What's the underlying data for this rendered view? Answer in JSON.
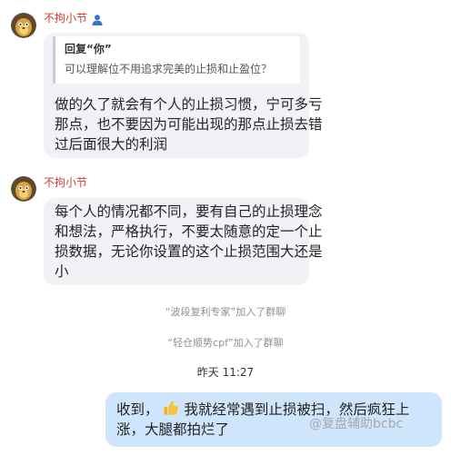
{
  "messages": [
    {
      "username": "不拘小节",
      "quote": {
        "title": "回复“你”",
        "text": "可以理解位不用追求完美的止损和止盈位？"
      },
      "lines": [
        "做的久了就会有个人的止损习惯，宁可多亏",
        "那点，也不要因为可能出现的那点止损去错",
        "过后面很大的利润"
      ]
    },
    {
      "username": "不拘小节",
      "lines": [
        "每个人的情况都不同，要有自己的止损理念",
        "和想法，严格执行，不要太随意的定一个止",
        "损数据，无论你设置的这个止损范围大还是",
        "小"
      ]
    }
  ],
  "system": [
    "“波段复利专家”加入了群聊",
    "“轻仓顺势cpf”加入了群聊"
  ],
  "timestamp": "昨天 11:27",
  "my_message": {
    "line1_before": "收到，",
    "line1_after": "我就经常遇到止损被扫，然后疯狂上",
    "line2": "涨，大腿都拍烂了",
    "emoji": "thumbs-up-icon"
  },
  "watermark": "@复盘辅助bcbc",
  "colors": {
    "username": "#d23c2a",
    "bubble_other": "#f1f2f6",
    "bubble_me": "#cfe5fb",
    "system_text": "#8b8f96",
    "user_icon": "#3b73c9"
  }
}
